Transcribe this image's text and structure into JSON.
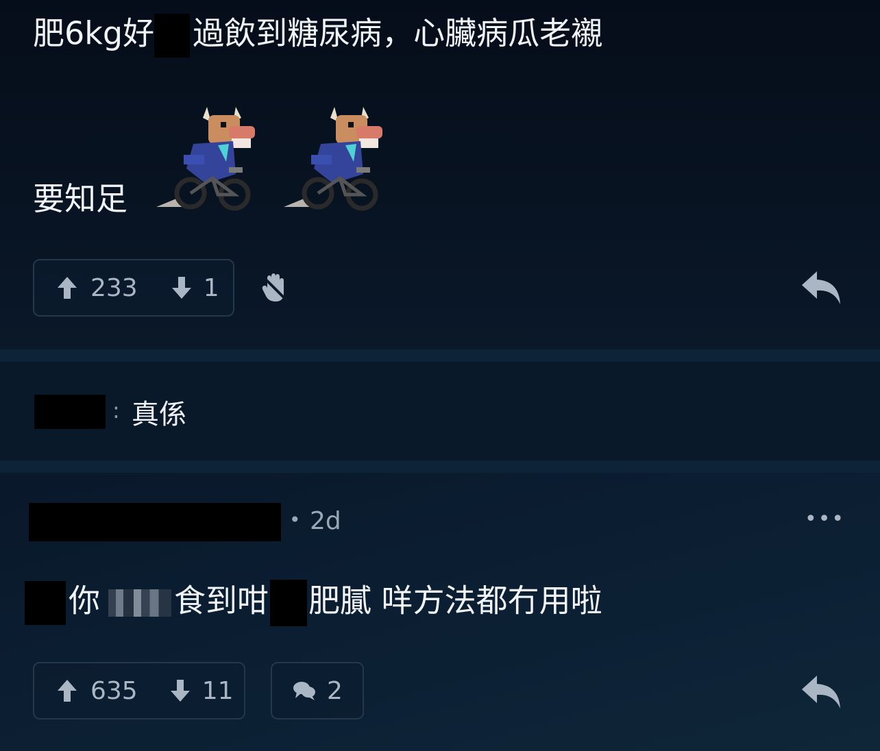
{
  "comment1": {
    "text_part1": "肥6kg好",
    "text_part2": "過飲到糖尿病，心臟病瓜老襯",
    "text_line2": "要知足",
    "emoji_name": "bull-on-bike",
    "upvotes": "233",
    "downvotes": "1"
  },
  "reply_preview": {
    "separator": ":",
    "text": "真係"
  },
  "comment2": {
    "timestamp": "2d",
    "dot": "•",
    "more": "•••",
    "text_part1": "你",
    "text_part2": "食到咁",
    "text_part3": "肥膩 咩方法都冇用啦",
    "upvotes": "635",
    "downvotes": "11",
    "replies": "2"
  },
  "icons": {
    "upvote": "arrow-up-icon",
    "downvote": "arrow-down-icon",
    "award": "hand-mask-icon",
    "reply": "reply-arrow-icon",
    "comments": "speech-bubbles-icon"
  },
  "colors": {
    "background": "#07101e",
    "separator": "#0d2337",
    "pill_border": "#24384c",
    "muted_text": "#aab6c3"
  }
}
